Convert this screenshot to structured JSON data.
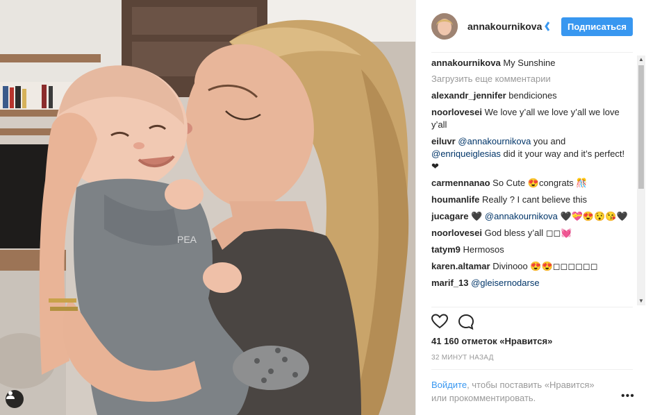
{
  "post": {
    "username": "annakournikova",
    "follow_label": "Подписаться"
  },
  "caption": {
    "user": "annakournikova",
    "text": "My Sunshine"
  },
  "load_more": "Загрузить еще комментарии",
  "comments": [
    {
      "user": "alexandr_jennifer",
      "text": "bendiciones"
    },
    {
      "user": "noorlovesei",
      "text": "We love y’all we love y’all we love y’all"
    },
    {
      "user": "eiluvr",
      "mention1": "@annakournikova",
      "mid": " you and ",
      "mention2": "@enriqueiglesias",
      "text": " did it your way and it’s perfect! ❤"
    },
    {
      "user": "carmennanao",
      "text": "So Cute 😍congrats 🎊"
    },
    {
      "user": "houmanlife",
      "text": "Really ? I cant believe this"
    },
    {
      "user": "jucagare",
      "pre": "🖤 ",
      "mention1": "@annakournikova",
      "text": " 🖤💝😍😯😘🖤"
    },
    {
      "user": "noorlovesei",
      "text": "God bless y’all ◻◻💓"
    },
    {
      "user": "tatym9",
      "text": "Hermosos"
    },
    {
      "user": "karen.altamar",
      "text": "Divinooo 😍😍◻◻◻◻◻◻"
    },
    {
      "user": "marif_13",
      "mention1": "@gleisernodarse",
      "text": ""
    }
  ],
  "likes": "41 160 отметок «Нравится»",
  "time_ago": "32 МИНУТ НАЗАД",
  "login": {
    "link": "Войдите",
    "text": ", чтобы поставить «Нравится» или прокомментировать."
  },
  "more_label": "•••",
  "colors": {
    "accent": "#3897f0",
    "mention": "#003569",
    "muted": "#999999"
  },
  "icons": [
    "user-tag-icon",
    "verified-badge-icon",
    "heart-icon",
    "comment-icon",
    "more-options-icon"
  ]
}
